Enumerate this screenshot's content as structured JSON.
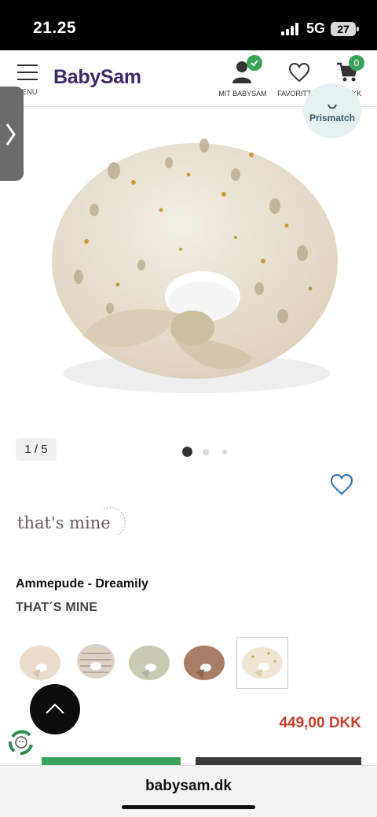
{
  "status_bar": {
    "time": "21.25",
    "network": "5G",
    "battery": "27"
  },
  "header": {
    "menu_label": "MENU",
    "logo": "BabySam",
    "account_label": "MIT BABYSAM",
    "favorites_label": "FAVORITTER",
    "cart_label": "0,00 DKK",
    "cart_count": "0"
  },
  "prismatch": {
    "label": "Prismatch"
  },
  "gallery": {
    "counter": "1 / 5",
    "total_images": 5,
    "active_index": 1
  },
  "product": {
    "title": "Ammepude - Dreamily",
    "brand": "THAT´S MINE",
    "brand_logo_text": "that's mine",
    "price": "449,00 DKK"
  },
  "variants": [
    {
      "name": "beige",
      "color": "#e9dccd"
    },
    {
      "name": "stripe",
      "color": "#ddd2c6"
    },
    {
      "name": "sage",
      "color": "#c9ccb2"
    },
    {
      "name": "brown",
      "color": "#a97e66"
    },
    {
      "name": "dreamily",
      "color": "#eee5d3",
      "selected": true
    }
  ],
  "colors": {
    "brand": "#3d2a6b",
    "accent_green": "#3aa35b",
    "price_red": "#c8412f"
  },
  "browser": {
    "url": "babysam.dk"
  }
}
